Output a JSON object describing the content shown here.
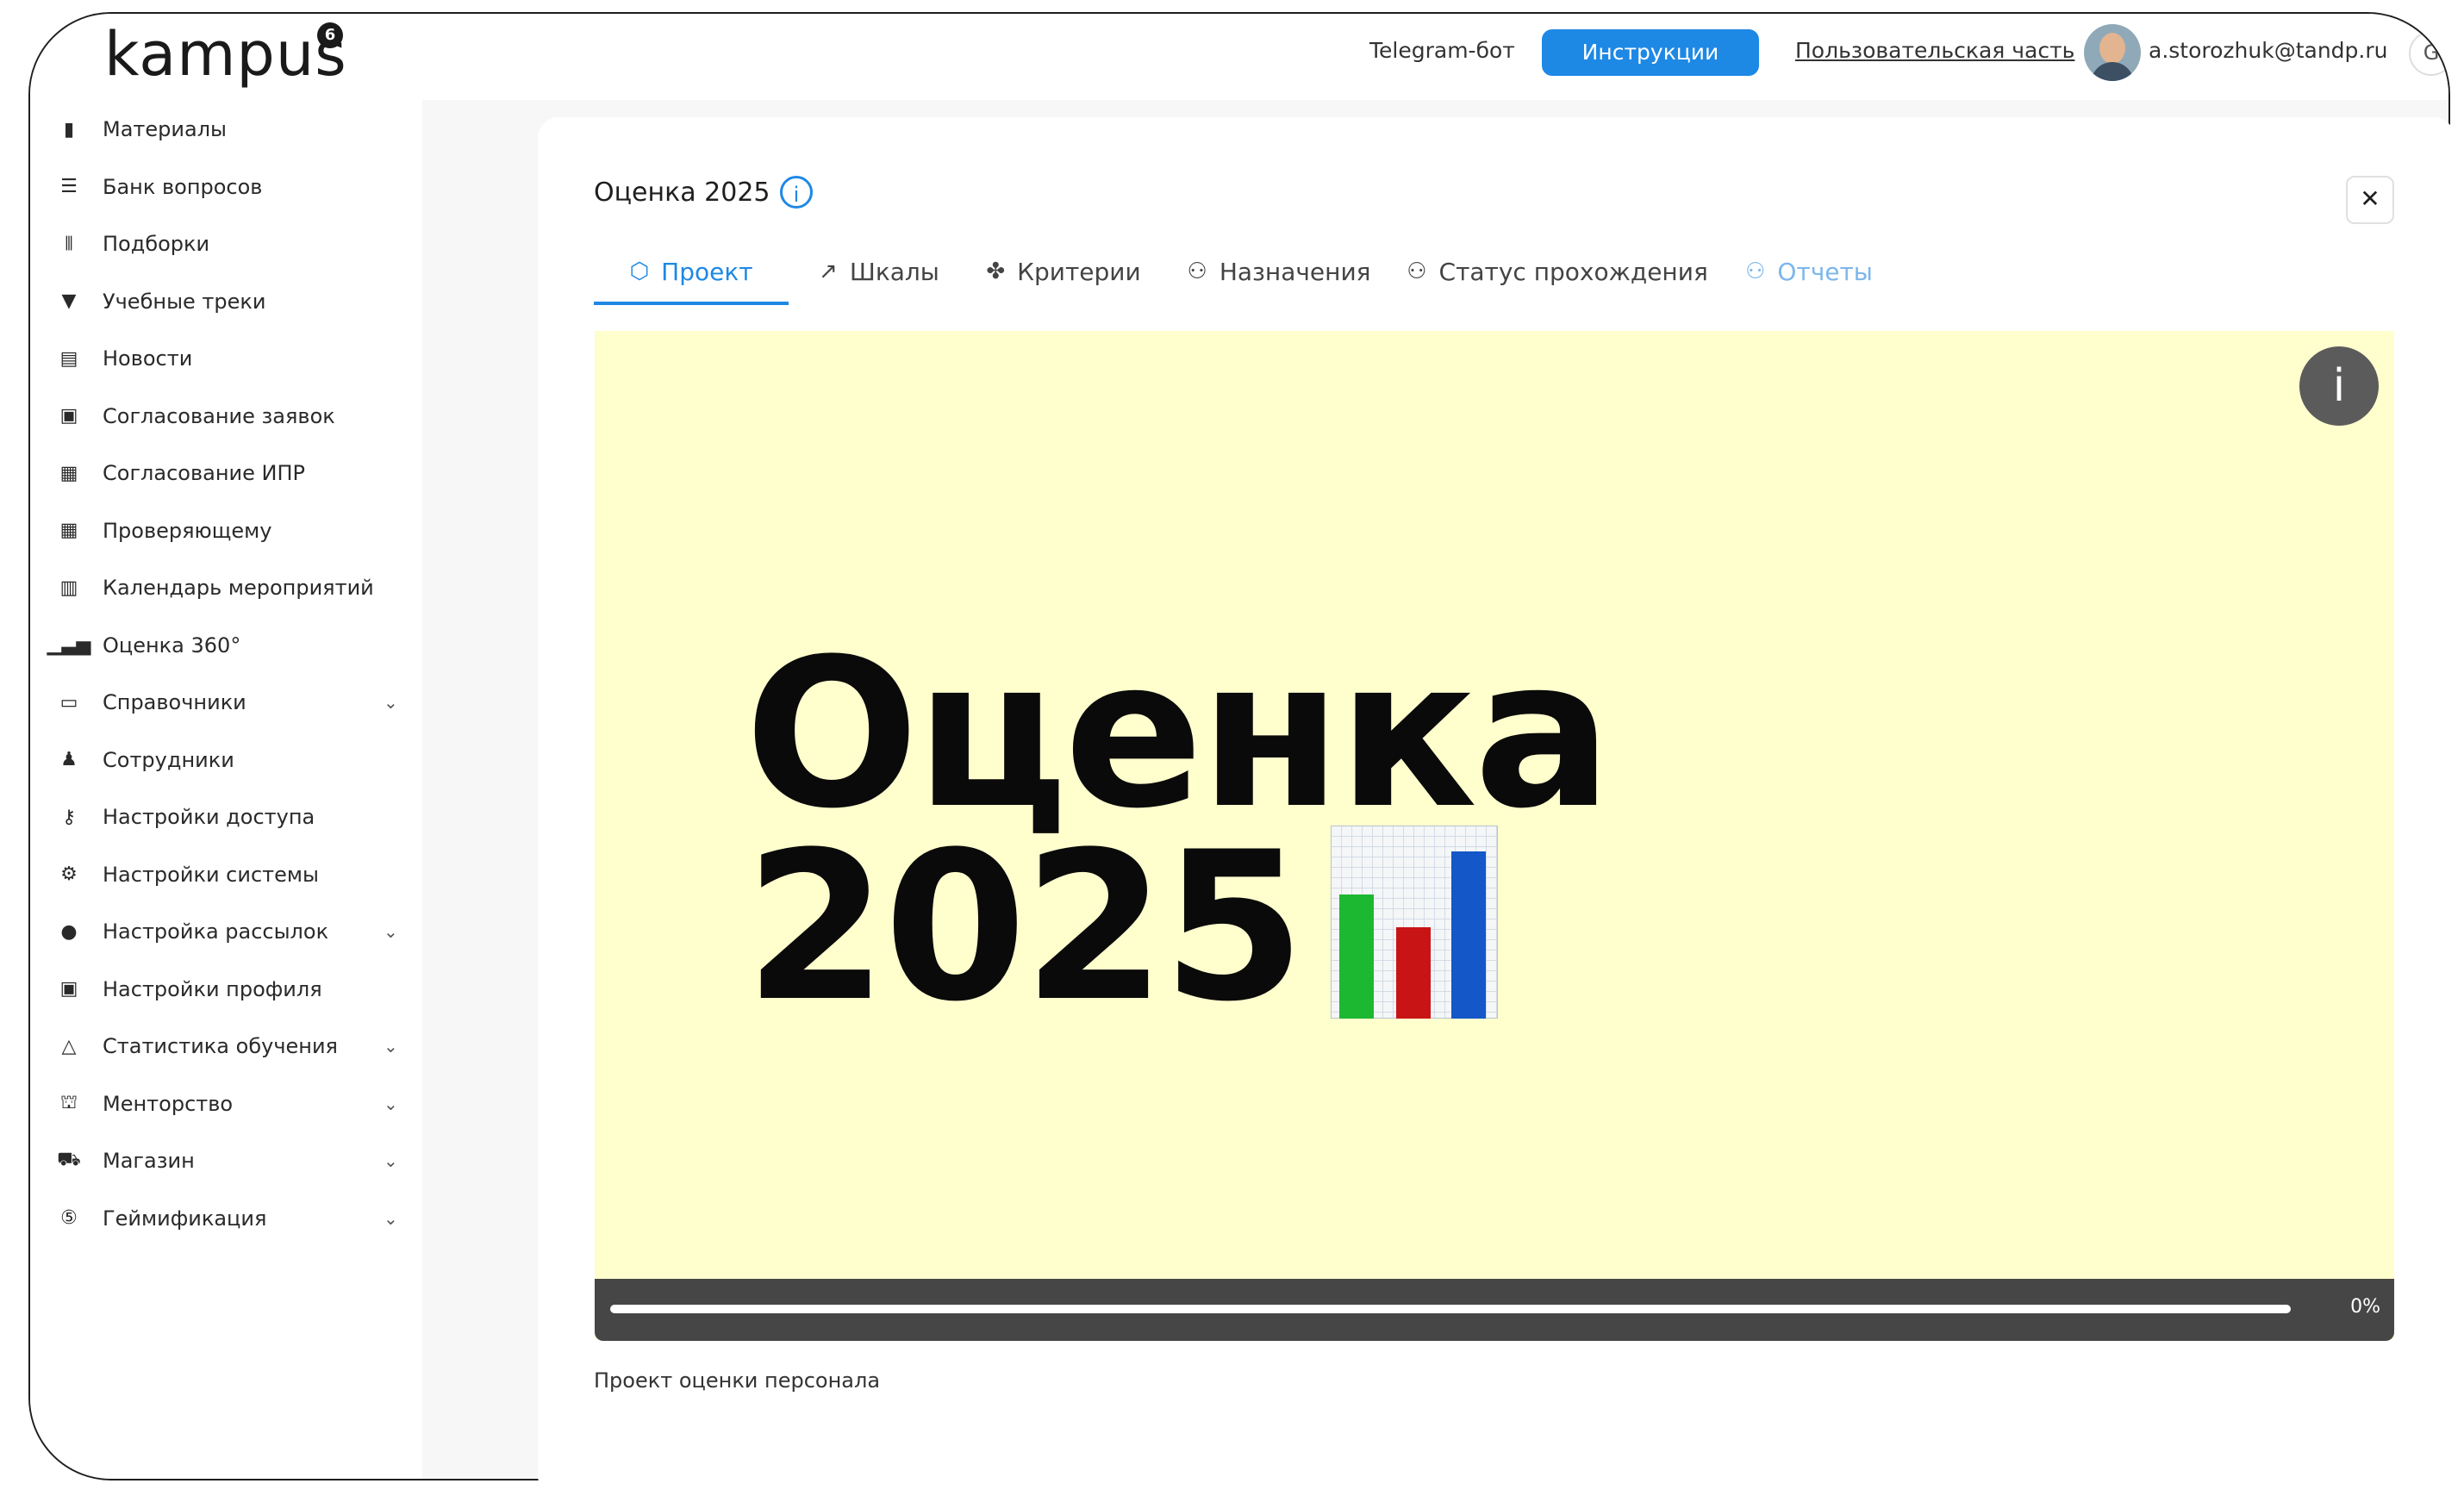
{
  "header": {
    "logo": "kampus",
    "logo_badge": "6",
    "telegram": "Telegram-бот",
    "instructions": "Инструкции",
    "user_part": "Пользовательская часть",
    "email": "a.storozhuk@tandp.ru",
    "logout_icon": "G"
  },
  "sidebar": {
    "items": [
      {
        "label": "Материалы",
        "icon": "book-icon",
        "glyph": "▮"
      },
      {
        "label": "Банк вопросов",
        "icon": "database-icon",
        "glyph": "☰"
      },
      {
        "label": "Подборки",
        "icon": "library-icon",
        "glyph": "⫴"
      },
      {
        "label": "Учебные треки",
        "icon": "bookmark-icon",
        "glyph": "▼"
      },
      {
        "label": "Новости",
        "icon": "newspaper-icon",
        "glyph": "▤"
      },
      {
        "label": "Согласование заявок",
        "icon": "clipboard-check-icon",
        "glyph": "▣"
      },
      {
        "label": "Согласование ИПР",
        "icon": "document-search-icon",
        "glyph": "▦"
      },
      {
        "label": "Проверяющему",
        "icon": "document-review-icon",
        "glyph": "▦"
      },
      {
        "label": "Календарь мероприятий",
        "icon": "calendar-icon",
        "glyph": "▥"
      },
      {
        "label": "Оценка 360°",
        "icon": "bar-chart-icon",
        "glyph": "▁▃▅"
      },
      {
        "label": "Справочники",
        "icon": "open-book-icon",
        "glyph": "▭",
        "chevron": "⌄"
      },
      {
        "label": "Сотрудники",
        "icon": "users-icon",
        "glyph": "♟"
      },
      {
        "label": "Настройки доступа",
        "icon": "key-icon",
        "glyph": "⚷"
      },
      {
        "label": "Настройки системы",
        "icon": "gear-icon",
        "glyph": "⚙"
      },
      {
        "label": "Настройка рассылок",
        "icon": "chat-icon",
        "glyph": "●",
        "chevron": "⌄"
      },
      {
        "label": "Настройки профиля",
        "icon": "profile-card-icon",
        "glyph": "▣"
      },
      {
        "label": "Статистика обучения",
        "icon": "warning-icon",
        "glyph": "△",
        "chevron": "⌄"
      },
      {
        "label": "Менторство",
        "icon": "org-chart-icon",
        "glyph": "⛫",
        "chevron": "⌄"
      },
      {
        "label": "Магазин",
        "icon": "cart-icon",
        "glyph": "⛟",
        "chevron": "⌄"
      },
      {
        "label": "Геймификация",
        "icon": "coin-icon",
        "glyph": "⑤",
        "chevron": "⌄"
      }
    ]
  },
  "card": {
    "title": "Оценка 2025",
    "info_glyph": "i",
    "close_glyph": "✕"
  },
  "tabs": [
    {
      "label": "Проект",
      "icon": "cube-icon",
      "glyph": "⬡",
      "state": "active"
    },
    {
      "label": "Шкалы",
      "icon": "trend-icon",
      "glyph": "↗",
      "state": "normal"
    },
    {
      "label": "Критерии",
      "icon": "criteria-icon",
      "glyph": "✤",
      "state": "normal"
    },
    {
      "label": "Назначения",
      "icon": "users-assign-icon",
      "glyph": "⚇",
      "state": "normal"
    },
    {
      "label": "Статус прохождения",
      "icon": "users-status-icon",
      "glyph": "⚇",
      "state": "normal"
    },
    {
      "label": "Отчеты",
      "icon": "users-report-icon",
      "glyph": "⚇",
      "state": "muted"
    }
  ],
  "media": {
    "line1": "Оценка",
    "line2": "2025",
    "info_glyph": "i",
    "progress": 0,
    "progress_label": "0%",
    "chart_colors": [
      "#1cb832",
      "#c81414",
      "#1457c8"
    ]
  },
  "description": "Проект оценки персонала"
}
